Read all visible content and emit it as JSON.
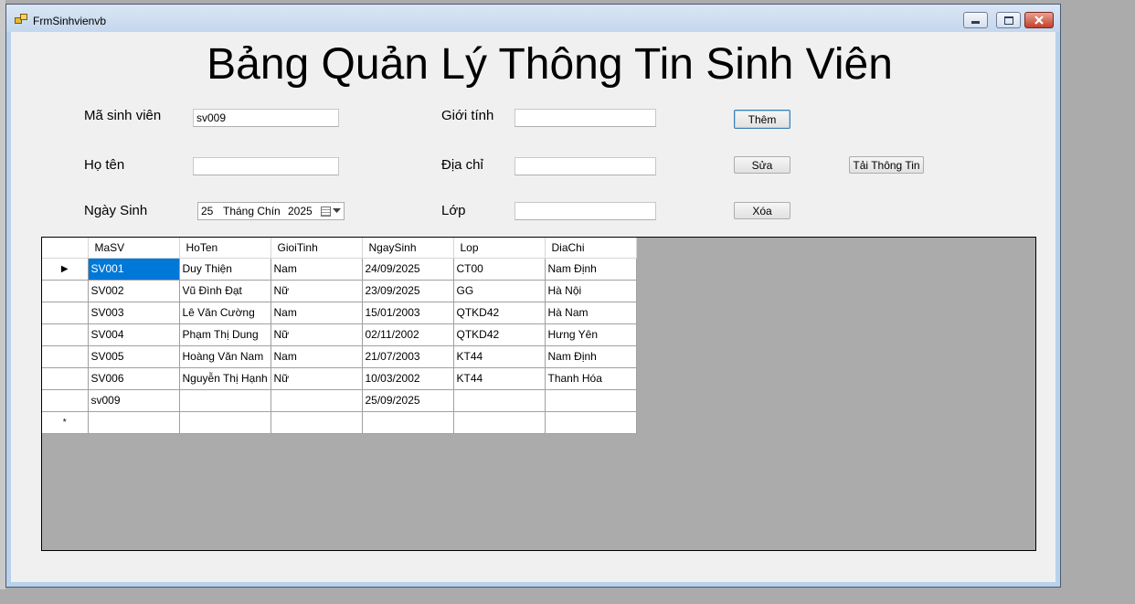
{
  "window": {
    "title": "FrmSinhvienvb",
    "icon": "app-form-icon"
  },
  "heading": "Bảng Quản Lý Thông Tin Sinh Viên",
  "form": {
    "masv_label": "Mã sinh viên",
    "masv_value": "sv009",
    "hoten_label": "Họ tên",
    "hoten_value": "",
    "ngaysinh_label": "Ngày Sinh",
    "ngaysinh": {
      "day": "25",
      "month": "Tháng Chín",
      "year": "2025"
    },
    "gioitinh_label": "Giới tính",
    "gioitinh_value": "",
    "diachi_label": "Địa chỉ",
    "diachi_value": "",
    "lop_label": "Lớp",
    "lop_value": ""
  },
  "buttons": {
    "them": "Thêm",
    "sua": "Sửa",
    "xoa": "Xóa",
    "tai": "Tải Thông Tin"
  },
  "grid": {
    "columns": [
      "MaSV",
      "HoTen",
      "GioiTinh",
      "NgaySinh",
      "Lop",
      "DiaChi"
    ],
    "rows": [
      [
        "SV001",
        "Duy Thiện",
        "Nam",
        "24/09/2025",
        "CT00",
        "Nam Định"
      ],
      [
        "SV002",
        "Vũ Đình Đạt",
        "Nữ",
        "23/09/2025",
        "GG",
        "Hà Nội"
      ],
      [
        "SV003",
        "Lê Văn Cường",
        "Nam",
        "15/01/2003",
        "QTKD42",
        "Hà Nam"
      ],
      [
        "SV004",
        "Phạm Thị Dung",
        "Nữ",
        "02/11/2002",
        "QTKD42",
        "Hưng Yên"
      ],
      [
        "SV005",
        "Hoàng Văn Nam",
        "Nam",
        "21/07/2003",
        "KT44",
        "Nam Định"
      ],
      [
        "SV006",
        "Nguyễn Thị Hạnh",
        "Nữ",
        "10/03/2002",
        "KT44",
        "Thanh Hóa"
      ],
      [
        "sv009",
        "",
        "",
        "25/09/2025",
        "",
        ""
      ]
    ],
    "current_row_marker": "▶",
    "new_row_marker": "*",
    "selection_color": "#0078d7"
  }
}
